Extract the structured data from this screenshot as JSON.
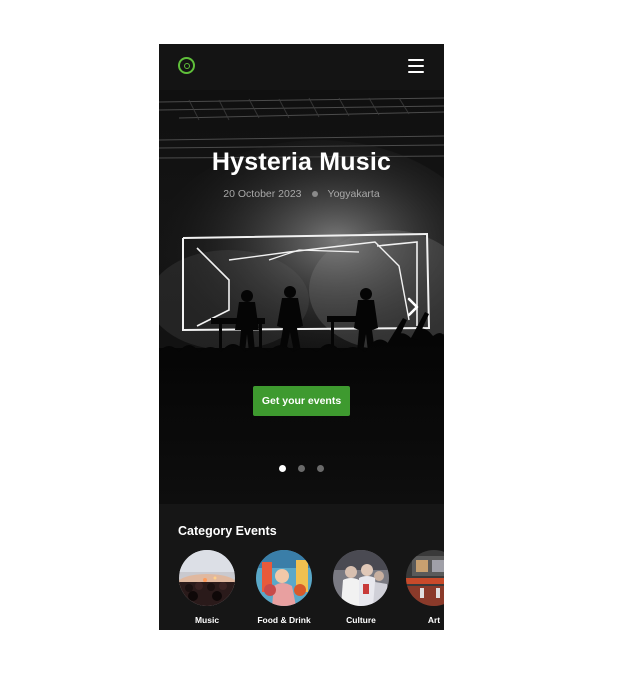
{
  "header": {
    "logo_icon": "vinyl-disc-icon",
    "menu_icon": "hamburger-menu-icon",
    "accent": "#5fbf3a"
  },
  "hero": {
    "title": "Hysteria Music",
    "date": "20 October 2023",
    "location": "Yogyakarta",
    "cta_label": "Get your events",
    "cta_color": "#3e9a2f",
    "next_icon": "chevron-right-icon",
    "slides": 3,
    "active_slide": 1
  },
  "categories": {
    "title": "Category Events",
    "items": [
      {
        "label": "Music"
      },
      {
        "label": "Food & Drink"
      },
      {
        "label": "Culture"
      },
      {
        "label": "Art"
      }
    ]
  }
}
